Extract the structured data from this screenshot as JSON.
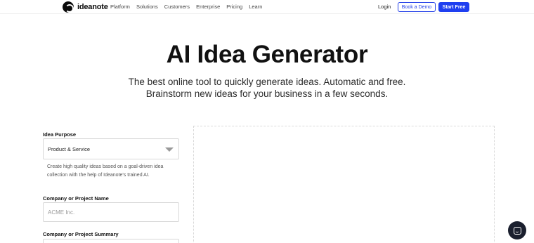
{
  "nav": {
    "logo_text": "ideanote",
    "links": [
      "Platform",
      "Solutions",
      "Customers",
      "Enterprise",
      "Pricing",
      "Learn"
    ],
    "login": "Login",
    "book_demo": "Book a Demo",
    "start_free": "Start Free"
  },
  "hero": {
    "title": "AI Idea Generator",
    "subtitle_line1": "The best online tool to quickly generate ideas. Automatic and free.",
    "subtitle_line2": "Brainstorm new ideas for your business in a few seconds."
  },
  "form": {
    "purpose_label": "Idea Purpose",
    "purpose_value": "Product & Service",
    "purpose_help": "Create high quality ideas based on a goal-driven idea collection with the help of Ideanote's trained AI.",
    "company_label": "Company or Project Name",
    "company_placeholder": "ACME Inc.",
    "summary_label": "Company or Project Summary"
  },
  "colors": {
    "accent": "#1f3ff0",
    "chat_bubble": "#1a1f2e"
  },
  "icons": {
    "logo": "ideanote-logo-icon",
    "select_caret": "chevron-down-icon",
    "chat": "chat-icon"
  }
}
